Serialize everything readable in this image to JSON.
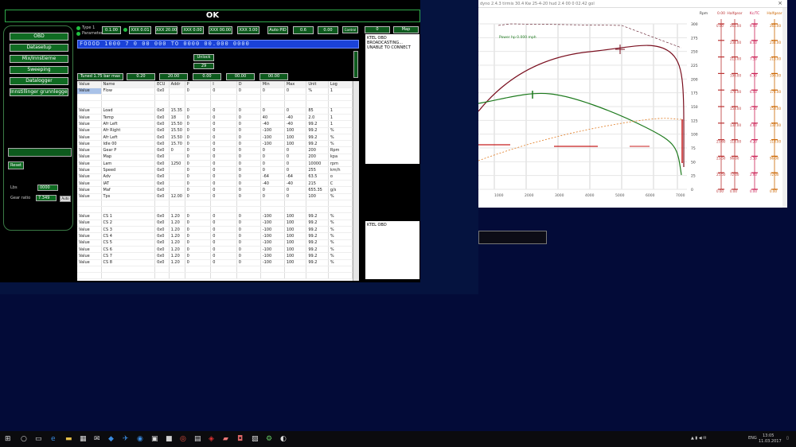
{
  "tuner": {
    "ok_label": "OK",
    "nav": [
      "OBD",
      "Datasetup",
      "Mix/Innstierne",
      "Sweeping",
      "Datalogger",
      "Innstillinger grunnleggende"
    ],
    "reset_label": "Reset",
    "field1_label": "Lbs",
    "field1_value": "0000",
    "field2_label": "Gear ratio",
    "field2_value": "7.349",
    "field_btn": "Auto",
    "radio1": "Type 1",
    "radio2": "Parameters",
    "toolbar": [
      "0.1.00",
      "XXX 0.01",
      "XXX 20.00",
      "XXX 0.00",
      "XXX 00.00",
      "XXX 3.00",
      "Auto PID",
      "0.6",
      "0.00",
      "Control"
    ],
    "blue_strip": "FOOOD 1000 7 0 00 000 TO 0000 00.000 0000",
    "center_btn1": "Unlock",
    "center_btn2": "29",
    "toolbar2": [
      "Tuned 1.75 bar max",
      "0.20",
      "20.00",
      "0.00",
      "00.00",
      "00.00"
    ],
    "msg1": "KTEL OBD BROADCASTING... UNABLE TO CONNECT",
    "msg2": "KTEL OBD",
    "top_right_btn1": "0",
    "top_right_btn2": "Map",
    "table": {
      "headers": [
        "Value",
        "Name",
        "ECU",
        "Addr",
        "P",
        "I",
        "D",
        "Min",
        "Max",
        "Unit",
        "Log"
      ],
      "rows": [
        [
          "Value",
          "Flow",
          "0x0",
          "",
          "0",
          "0",
          "0",
          "0",
          "0",
          "%",
          "1"
        ],
        [
          "",
          "",
          "",
          "",
          "",
          "",
          "",
          "",
          "",
          "",
          ""
        ],
        [
          "",
          "",
          "",
          "",
          "",
          "",
          "",
          "",
          "",
          "",
          ""
        ],
        [
          "Value",
          "Load",
          "0x0",
          "15.35",
          "0",
          "0",
          "0",
          "0",
          "0",
          "85",
          "1"
        ],
        [
          "Value",
          "Temp",
          "0x0",
          "18",
          "0",
          "0",
          "0",
          "40",
          "-40",
          "2.0",
          "1"
        ],
        [
          "Value",
          "Afr Left",
          "0x0",
          "15.50",
          "0",
          "0",
          "0",
          "-40",
          "-40",
          "99.2",
          "1"
        ],
        [
          "Value",
          "Afr Right",
          "0x0",
          "15.50",
          "0",
          "0",
          "0",
          "-100",
          "100",
          "99.2",
          "%"
        ],
        [
          "Value",
          "Afr Left",
          "0x0",
          "15.50",
          "0",
          "0",
          "0",
          "-100",
          "100",
          "99.2",
          "%"
        ],
        [
          "Value",
          "Idle 00",
          "0x0",
          "15.70",
          "0",
          "0",
          "0",
          "-100",
          "100",
          "99.2",
          "%"
        ],
        [
          "Value",
          "Gear P",
          "0x0",
          "0",
          "0",
          "0",
          "0",
          "0",
          "0",
          "200",
          "Rpm"
        ],
        [
          "Value",
          "Map",
          "0x0",
          "",
          "0",
          "0",
          "0",
          "0",
          "0",
          "200",
          "kpa"
        ],
        [
          "Value",
          "Lam",
          "0x0",
          "1250",
          "0",
          "0",
          "0",
          "0",
          "0",
          "10000",
          "rpm"
        ],
        [
          "Value",
          "Speed",
          "0x0",
          "",
          "0",
          "0",
          "0",
          "0",
          "0",
          "255",
          "km/h"
        ],
        [
          "Value",
          "Adv",
          "0x0",
          "",
          "0",
          "0",
          "0",
          "-64",
          "-64",
          "63.5",
          "o"
        ],
        [
          "Value",
          "IAT",
          "0x0",
          "",
          "0",
          "0",
          "0",
          "-40",
          "-40",
          "215",
          "C"
        ],
        [
          "Value",
          "Maf",
          "0x0",
          "",
          "0",
          "0",
          "0",
          "0",
          "0",
          "655.35",
          "g/s"
        ],
        [
          "Value",
          "Tps",
          "0x0",
          "12.00",
          "0",
          "0",
          "0",
          "0",
          "0",
          "100",
          "%"
        ],
        [
          "",
          "",
          "",
          "",
          "",
          "",
          "",
          "",
          "",
          "",
          ""
        ],
        [
          "",
          "",
          "",
          "",
          "",
          "",
          "",
          "",
          "",
          "",
          ""
        ],
        [
          "Value",
          "CS 1",
          "0x0",
          "1.20",
          "0",
          "0",
          "0",
          "-100",
          "100",
          "99.2",
          "%"
        ],
        [
          "Value",
          "CS 2",
          "0x0",
          "1.20",
          "0",
          "0",
          "0",
          "-100",
          "100",
          "99.2",
          "%"
        ],
        [
          "Value",
          "CS 3",
          "0x0",
          "1.20",
          "0",
          "0",
          "0",
          "-100",
          "100",
          "99.2",
          "%"
        ],
        [
          "Value",
          "CS 4",
          "0x0",
          "1.20",
          "0",
          "0",
          "0",
          "-100",
          "100",
          "99.2",
          "%"
        ],
        [
          "Value",
          "CS 5",
          "0x0",
          "1.20",
          "0",
          "0",
          "0",
          "-100",
          "100",
          "99.2",
          "%"
        ],
        [
          "Value",
          "CS 6",
          "0x0",
          "1.20",
          "0",
          "0",
          "0",
          "-100",
          "100",
          "99.2",
          "%"
        ],
        [
          "Value",
          "CS 7",
          "0x0",
          "1.20",
          "0",
          "0",
          "0",
          "-100",
          "100",
          "99.2",
          "%"
        ],
        [
          "Value",
          "CS 8",
          "0x0",
          "1.20",
          "0",
          "0",
          "0",
          "-100",
          "100",
          "99.2",
          "%"
        ],
        [
          "",
          "",
          "",
          "",
          "",
          "",
          "",
          "",
          "",
          "",
          ""
        ],
        [
          "",
          "",
          "",
          "",
          "",
          "",
          "",
          "",
          "",
          "",
          ""
        ]
      ]
    }
  },
  "dyno": {
    "title": "dyno 2.4.3 tirmis     30.4 Kw     25-4-20 hud     2.4 00 0     02.42 gol",
    "close": "×",
    "legend_label": "Power hp 0.000 mph",
    "y_ticks": [
      "300",
      "275",
      "250",
      "225",
      "200",
      "175",
      "150",
      "125",
      "100",
      "75",
      "50",
      "25",
      "0"
    ],
    "x_ticks": [
      "1000",
      "2000",
      "3000",
      "4000",
      "5000",
      "6000",
      "7000"
    ],
    "side_headers": [
      "Rpm",
      "0.00",
      "Halfgear",
      "Kc/TC",
      "Halfgear"
    ],
    "side_values": [
      [
        "",
        "0.00",
        "265.00",
        "9.00",
        "265.00"
      ],
      [
        "",
        "",
        "234.00",
        "8.00",
        "234.00"
      ],
      [
        "",
        "",
        "215.00",
        "7.50",
        "215.00"
      ],
      [
        "",
        "",
        "196.00",
        "6.70",
        "196.00"
      ],
      [
        "",
        "",
        "174.00",
        "6.00",
        "174.00"
      ],
      [
        "",
        "",
        "153.00",
        "5.30",
        "153.00"
      ],
      [
        "",
        "",
        "132.00",
        "4.60",
        "132.00"
      ],
      [
        "",
        "25.60",
        "118.00",
        "4.20",
        "118.00"
      ],
      [
        "",
        "25.50",
        "96.00",
        "3.50",
        "96.00"
      ],
      [
        "",
        "25.50",
        "72.00",
        "2.60",
        "72.00"
      ],
      [
        "",
        "0.00",
        "0.00",
        "0.00",
        "0.00"
      ]
    ],
    "colors": {
      "power": "#7a0f1f",
      "torque": "#1d7a1d",
      "boost": "#e07a20",
      "afr": "#c81e1e"
    }
  },
  "taskbar": {
    "icons": [
      "windows-icon",
      "search-icon",
      "task-view-icon",
      "edge-icon",
      "file-explorer-icon",
      "store-icon",
      "mail-icon",
      "chrome-icon",
      "app1-icon",
      "app2-icon",
      "app3-icon",
      "app4-icon",
      "app5-icon"
    ],
    "tray_lang": "ENG",
    "time": "13:05",
    "date": "11.03.2017"
  }
}
